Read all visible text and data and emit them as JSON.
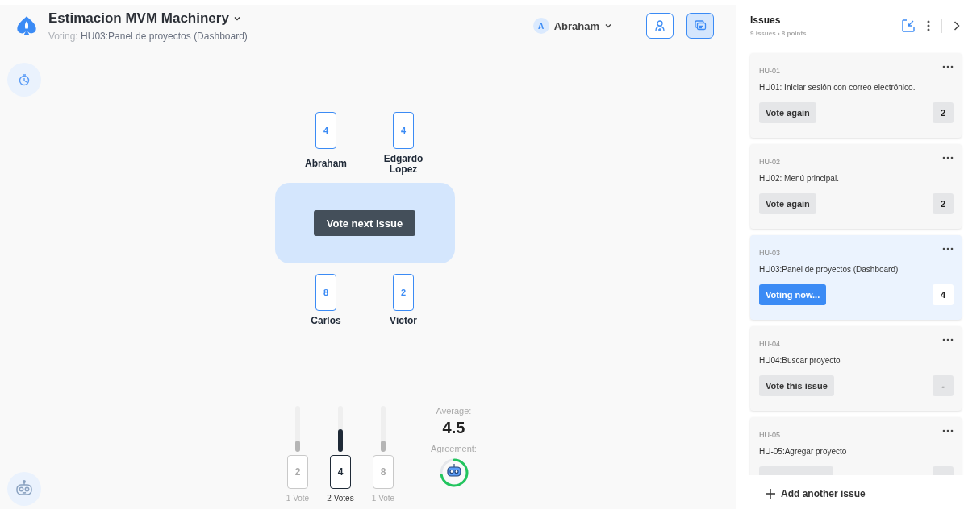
{
  "project": {
    "title": "Estimacion MVM Machinery",
    "voting_label": "Voting:",
    "voting_issue": "HU03:Panel de proyectos (Dashboard)"
  },
  "user": {
    "initial": "A",
    "name": "Abraham"
  },
  "header_buttons": [
    {
      "kind": "invite",
      "selected": false
    },
    {
      "kind": "cards",
      "selected": true
    }
  ],
  "players_top": [
    {
      "name": "Abraham",
      "card": "4"
    },
    {
      "name": "Edgardo Lopez",
      "card": "4"
    }
  ],
  "table": {
    "action": "Vote next issue"
  },
  "players_bottom": [
    {
      "name": "Carlos",
      "card": "8"
    },
    {
      "name": "Victor",
      "card": "2"
    }
  ],
  "results": [
    {
      "card": "2",
      "votes": "1 Vote",
      "level": 0.25,
      "selected": false
    },
    {
      "card": "4",
      "votes": "2 Votes",
      "level": 0.5,
      "selected": true
    },
    {
      "card": "8",
      "votes": "1 Vote",
      "level": 0.25,
      "selected": false
    }
  ],
  "average": {
    "label": "Average:",
    "value": "4.5"
  },
  "agreement": {
    "label": "Agreement:"
  },
  "issues_panel": {
    "title": "Issues",
    "summary": "9 issues • 8 points",
    "add_label": "Add another issue"
  },
  "issues": [
    {
      "key": "HU-01",
      "title": "HU01: Iniciar sesión con correo electrónico.",
      "kind": "again",
      "action": "Vote again",
      "points": "2",
      "selected": false
    },
    {
      "key": "HU-02",
      "title": "HU02: Menú principal.",
      "kind": "again",
      "action": "Vote again",
      "points": "2",
      "selected": false
    },
    {
      "key": "HU-03",
      "title": "HU03:Panel de proyectos (Dashboard)",
      "kind": "voting",
      "action": "Voting now...",
      "points": "4",
      "selected": true
    },
    {
      "key": "HU-04",
      "title": "HU04:Buscar proyecto",
      "kind": "vote",
      "action": "Vote this issue",
      "points": "-",
      "selected": false
    },
    {
      "key": "HU-05",
      "title": "HU-05:Agregar proyecto",
      "kind": "vote",
      "selected": false
    }
  ]
}
